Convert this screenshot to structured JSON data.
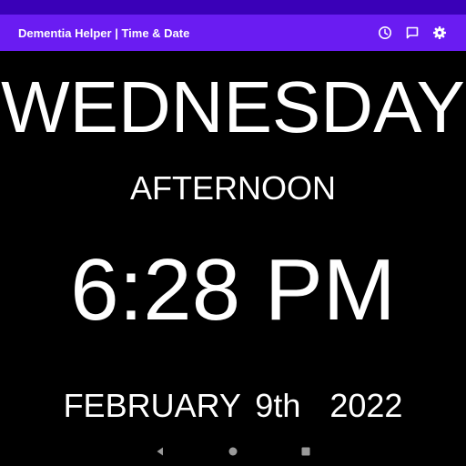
{
  "app": {
    "title": "Dementia Helper | Time & Date",
    "colors": {
      "status_bar": "#3a00b8",
      "app_bar": "#6a1cf2",
      "background": "#000000",
      "text": "#ffffff"
    },
    "actions": [
      {
        "icon": "clock-icon"
      },
      {
        "icon": "message-icon"
      },
      {
        "icon": "gear-icon"
      }
    ]
  },
  "display": {
    "day": "WEDNESDAY",
    "period": "AFTERNOON",
    "time": "6:28 PM",
    "date": "FEBRUARY 9th  2022"
  },
  "navigation": {
    "buttons": [
      {
        "icon": "back-triangle-icon"
      },
      {
        "icon": "home-circle-icon"
      },
      {
        "icon": "recents-square-icon"
      }
    ]
  }
}
